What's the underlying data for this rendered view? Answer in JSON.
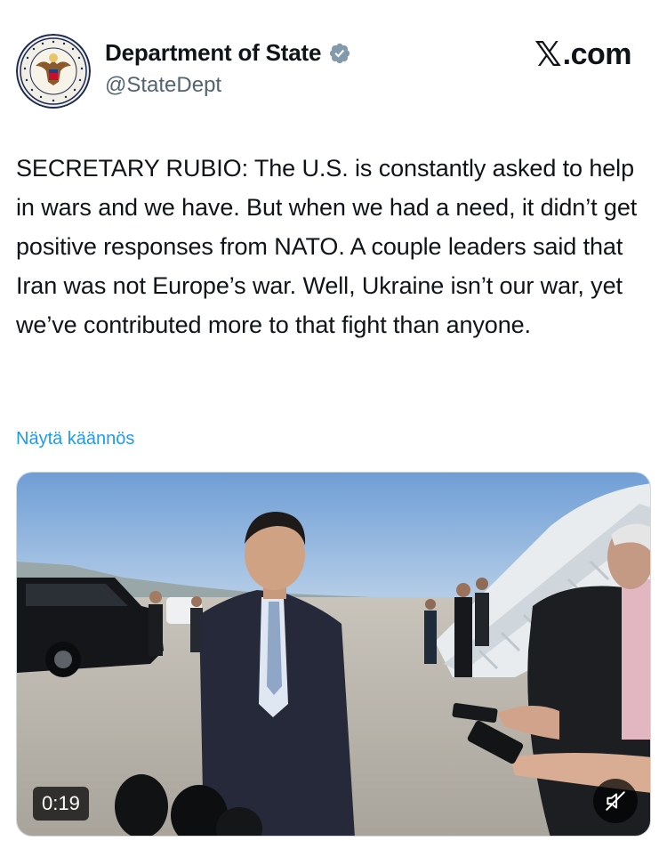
{
  "author": {
    "display_name": "Department of State",
    "handle": "@StateDept",
    "verified": true,
    "avatar_icon": "us-department-of-state-seal-icon"
  },
  "brand": {
    "x_glyph": "𝕏",
    "text": ".com"
  },
  "tweet": {
    "text": "SECRETARY RUBIO: The U.S. is constantly asked to help in wars and we have. But when we had a need, it didn’t get positive responses from NATO. A couple leaders said that Iran was not Europe’s war. Well, Ukraine isn’t our war, yet we’ve contributed more to that fight than anyone."
  },
  "translate_link": "Näytä käännös",
  "media": {
    "type": "video",
    "duration": "0:19",
    "muted": true
  },
  "colors": {
    "link": "#1d9bf0",
    "verified_badge": "#829aab",
    "text": "#0f1419",
    "secondary_text": "#536471"
  }
}
